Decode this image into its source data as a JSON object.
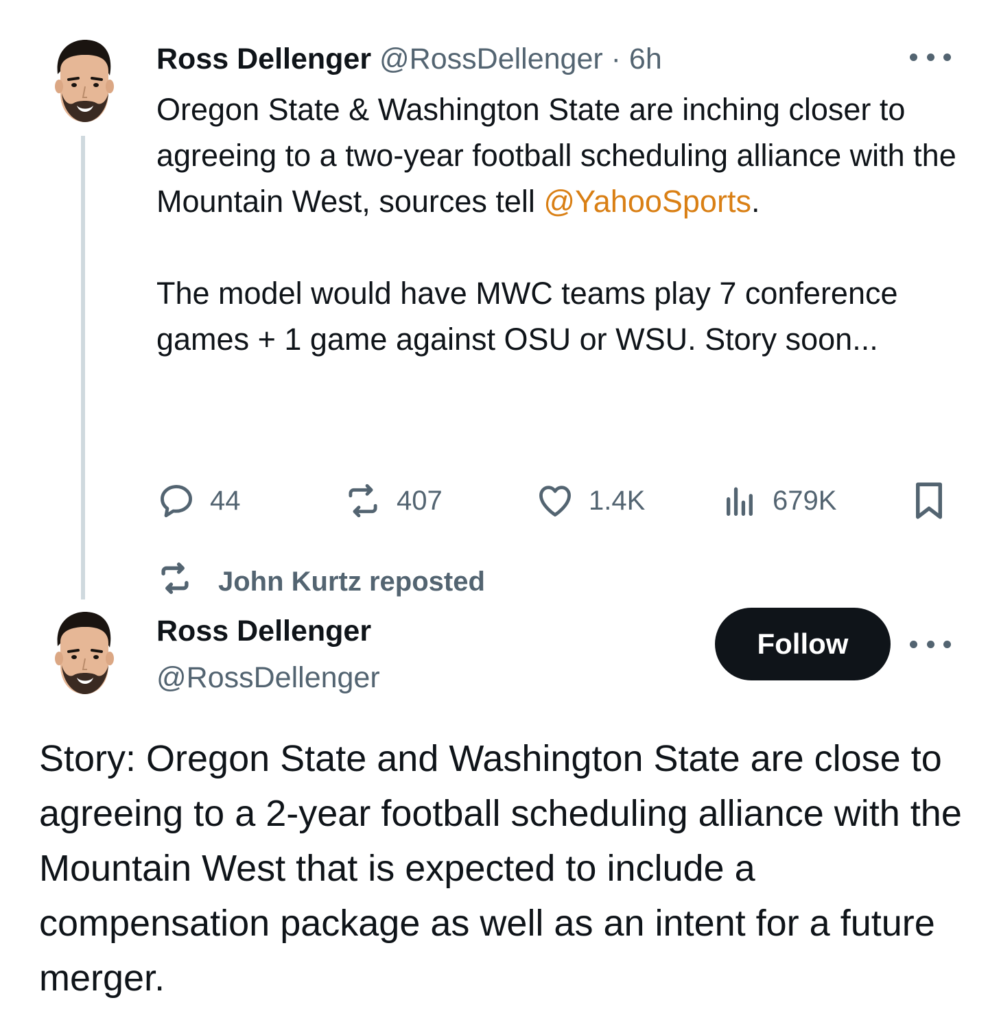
{
  "first_tweet": {
    "author_name": "Ross Dellenger",
    "author_handle": "@RossDellenger",
    "separator": "·",
    "time": "6h",
    "text_part1": "Oregon State & Washington State are inching closer to agreeing to a two-year football scheduling alliance with the Mountain West, sources tell ",
    "mention": "@YahooSports",
    "text_part1_end": ".",
    "text_part2": "The model would have MWC teams play 7 conference games + 1 game against OSU or WSU. Story soon...",
    "stats": {
      "replies": "44",
      "reposts": "407",
      "likes": "1.4K",
      "views": "679K"
    }
  },
  "repost_banner": {
    "label": "John Kurtz reposted"
  },
  "second_tweet": {
    "author_name": "Ross Dellenger",
    "author_handle": "@RossDellenger",
    "follow_label": "Follow",
    "text": "Story: Oregon State and Washington State are close to agreeing to a 2-year football scheduling alliance with the Mountain West that is expected to include a compensation package as well as an intent for a future merger."
  },
  "colors": {
    "text": "#0f1419",
    "muted": "#536471",
    "mention": "#d97f14",
    "thread_line": "#cfd9de",
    "follow_bg": "#0f1419"
  },
  "icons": {
    "reply": "reply-icon",
    "repost": "repost-icon",
    "like": "heart-icon",
    "views": "views-icon",
    "bookmark": "bookmark-icon",
    "more": "more-icon"
  }
}
